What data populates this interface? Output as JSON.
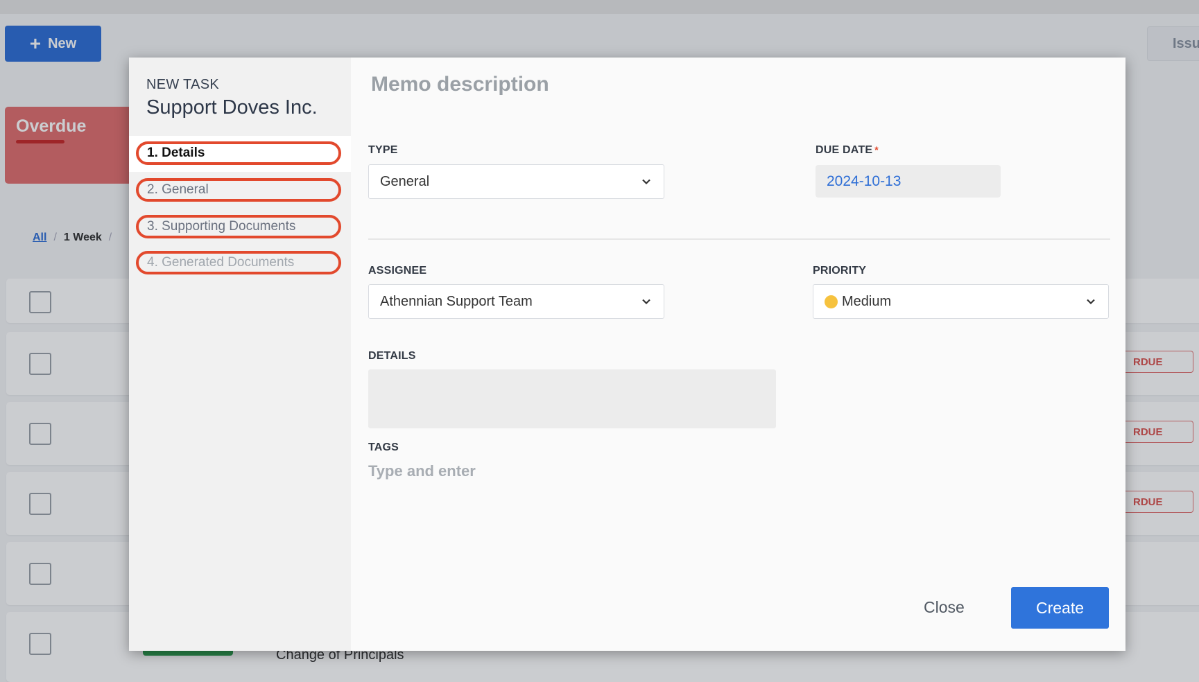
{
  "background": {
    "new_button": {
      "label": "New",
      "icon": "plus-icon"
    },
    "issue_button": {
      "label": "Issu"
    },
    "overdue_card": {
      "title": "Overdue"
    },
    "filters": {
      "all": "All",
      "week": "1 Week",
      "sep": "/"
    },
    "rows": [
      {
        "status": ""
      },
      {
        "status": "RDUE"
      },
      {
        "status": "RDUE"
      },
      {
        "status": "RDUE"
      },
      {
        "status": ""
      },
      {
        "status": ""
      }
    ],
    "last_row_text": "Change of Principals"
  },
  "modal": {
    "kicker": "NEW TASK",
    "title": "Support Doves Inc.",
    "steps": [
      {
        "label": "1. Details"
      },
      {
        "label": "2. General"
      },
      {
        "label": "3. Supporting Documents"
      },
      {
        "label": "4. Generated Documents"
      }
    ],
    "memo_title": "Memo description",
    "type": {
      "label": "TYPE",
      "value": "General"
    },
    "due_date": {
      "label": "DUE DATE",
      "required_mark": "*",
      "value": "2024-10-13"
    },
    "assignee": {
      "label": "ASSIGNEE",
      "value": "Athennian Support Team"
    },
    "priority": {
      "label": "PRIORITY",
      "value": "Medium",
      "color": "#f6c23e"
    },
    "details": {
      "label": "DETAILS",
      "value": ""
    },
    "tags": {
      "label": "TAGS",
      "placeholder": "Type and enter"
    },
    "actions": {
      "close": "Close",
      "create": "Create"
    }
  },
  "colors": {
    "accent": "#2f6fd6",
    "step_outline": "#e2492d",
    "overdue": "#e06f6f"
  }
}
